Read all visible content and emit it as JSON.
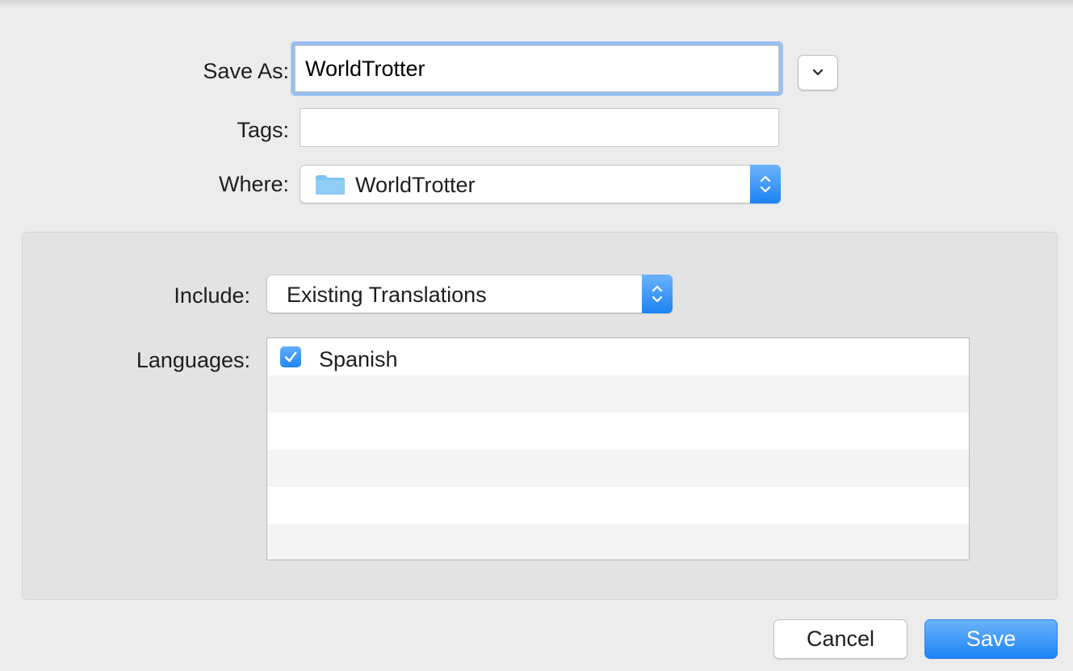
{
  "save_as": {
    "label": "Save As:",
    "value": "WorldTrotter"
  },
  "tags": {
    "label": "Tags:",
    "value": ""
  },
  "where": {
    "label": "Where:",
    "value": "WorldTrotter",
    "icon": "folder-icon"
  },
  "options": {
    "include_label": "Include:",
    "include_value": "Existing Translations",
    "languages_label": "Languages:",
    "languages": [
      {
        "name": "Spanish",
        "checked": true
      }
    ]
  },
  "buttons": {
    "cancel": "Cancel",
    "save": "Save"
  },
  "colors": {
    "accent": "#1c83f5",
    "focus_ring": "#97bff0",
    "folder": "#7ec3f1"
  }
}
